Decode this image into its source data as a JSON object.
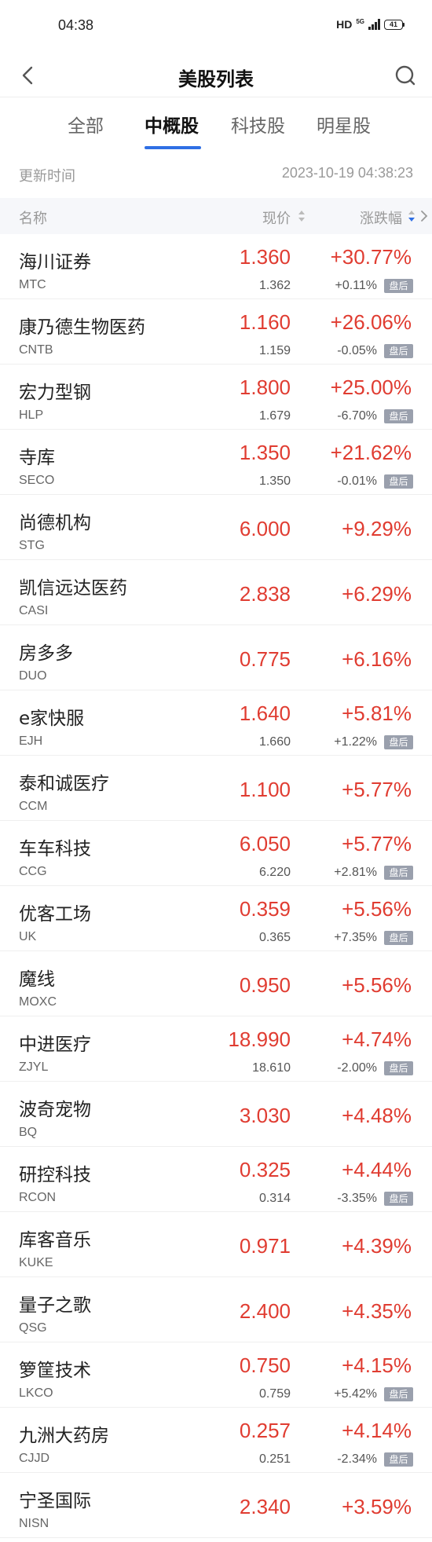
{
  "status_bar": {
    "time": "04:38",
    "network": "HD",
    "net_type": "5G",
    "battery": "41"
  },
  "nav": {
    "title": "美股列表"
  },
  "tabs": [
    {
      "label": "全部",
      "active": false
    },
    {
      "label": "中概股",
      "active": true
    },
    {
      "label": "科技股",
      "active": false
    },
    {
      "label": "明星股",
      "active": false
    }
  ],
  "update": {
    "label": "更新时间",
    "time": "2023-10-19 04:38:23"
  },
  "columns": {
    "name": "名称",
    "price": "现价",
    "change": "涨跌幅"
  },
  "colors": {
    "up": "#e03c31",
    "accent": "#2f6fe4",
    "badge": "#9aa0ad"
  },
  "stocks": [
    {
      "name": "海川证券",
      "code": "MTC",
      "price": "1.360",
      "change": "+30.77%",
      "ah_price": "1.362",
      "ah_change": "+0.11%",
      "ah_label": "盘后"
    },
    {
      "name": "康乃德生物医药",
      "code": "CNTB",
      "price": "1.160",
      "change": "+26.06%",
      "ah_price": "1.159",
      "ah_change": "-0.05%",
      "ah_label": "盘后"
    },
    {
      "name": "宏力型钢",
      "code": "HLP",
      "price": "1.800",
      "change": "+25.00%",
      "ah_price": "1.679",
      "ah_change": "-6.70%",
      "ah_label": "盘后"
    },
    {
      "name": "寺库",
      "code": "SECO",
      "price": "1.350",
      "change": "+21.62%",
      "ah_price": "1.350",
      "ah_change": "-0.01%",
      "ah_label": "盘后"
    },
    {
      "name": "尚德机构",
      "code": "STG",
      "price": "6.000",
      "change": "+9.29%"
    },
    {
      "name": "凯信远达医药",
      "code": "CASI",
      "price": "2.838",
      "change": "+6.29%"
    },
    {
      "name": "房多多",
      "code": "DUO",
      "price": "0.775",
      "change": "+6.16%"
    },
    {
      "name": "e家快服",
      "code": "EJH",
      "price": "1.640",
      "change": "+5.81%",
      "ah_price": "1.660",
      "ah_change": "+1.22%",
      "ah_label": "盘后"
    },
    {
      "name": "泰和诚医疗",
      "code": "CCM",
      "price": "1.100",
      "change": "+5.77%"
    },
    {
      "name": "车车科技",
      "code": "CCG",
      "price": "6.050",
      "change": "+5.77%",
      "ah_price": "6.220",
      "ah_change": "+2.81%",
      "ah_label": "盘后"
    },
    {
      "name": "优客工场",
      "code": "UK",
      "price": "0.359",
      "change": "+5.56%",
      "ah_price": "0.365",
      "ah_change": "+7.35%",
      "ah_label": "盘后"
    },
    {
      "name": "魔线",
      "code": "MOXC",
      "price": "0.950",
      "change": "+5.56%"
    },
    {
      "name": "中进医疗",
      "code": "ZJYL",
      "price": "18.990",
      "change": "+4.74%",
      "ah_price": "18.610",
      "ah_change": "-2.00%",
      "ah_label": "盘后"
    },
    {
      "name": "波奇宠物",
      "code": "BQ",
      "price": "3.030",
      "change": "+4.48%"
    },
    {
      "name": "研控科技",
      "code": "RCON",
      "price": "0.325",
      "change": "+4.44%",
      "ah_price": "0.314",
      "ah_change": "-3.35%",
      "ah_label": "盘后"
    },
    {
      "name": "库客音乐",
      "code": "KUKE",
      "price": "0.971",
      "change": "+4.39%"
    },
    {
      "name": "量子之歌",
      "code": "QSG",
      "price": "2.400",
      "change": "+4.35%"
    },
    {
      "name": "箩筐技术",
      "code": "LKCO",
      "price": "0.750",
      "change": "+4.15%",
      "ah_price": "0.759",
      "ah_change": "+5.42%",
      "ah_label": "盘后"
    },
    {
      "name": "九洲大药房",
      "code": "CJJD",
      "price": "0.257",
      "change": "+4.14%",
      "ah_price": "0.251",
      "ah_change": "-2.34%",
      "ah_label": "盘后"
    },
    {
      "name": "宁圣国际",
      "code": "NISN",
      "price": "2.340",
      "change": "+3.59%"
    }
  ]
}
